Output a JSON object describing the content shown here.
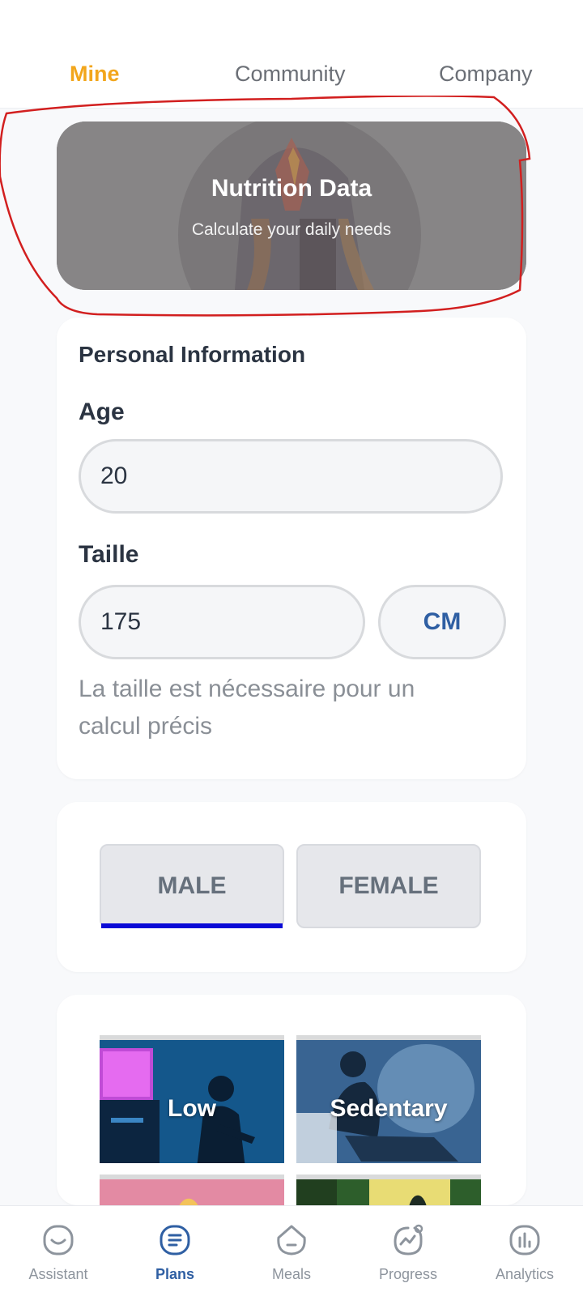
{
  "tabs": {
    "mine": "Mine",
    "community": "Community",
    "company": "Company",
    "active": "Mine"
  },
  "hero": {
    "title": "Nutrition Data",
    "subtitle": "Calculate your daily needs"
  },
  "personal": {
    "section_title": "Personal Information",
    "age_label": "Age",
    "age_value": "20",
    "height_label": "Taille",
    "height_value": "175",
    "height_unit": "CM",
    "height_hint": "La taille est nécessaire pour un calcul précis"
  },
  "gender": {
    "male": "MALE",
    "female": "FEMALE",
    "selected": "MALE"
  },
  "activity": {
    "options": [
      "Low",
      "Sedentary"
    ]
  },
  "bottom_nav": {
    "items": [
      {
        "label": "Assistant",
        "icon": "assistant-face-icon"
      },
      {
        "label": "Plans",
        "icon": "plans-list-icon"
      },
      {
        "label": "Meals",
        "icon": "meals-icon"
      },
      {
        "label": "Progress",
        "icon": "progress-chart-icon"
      },
      {
        "label": "Analytics",
        "icon": "analytics-bars-icon"
      }
    ],
    "active": "Plans"
  },
  "colors": {
    "accent_orange": "#f2a61c",
    "active_blue": "#2f5fa3",
    "selection_bar": "#0a0ad6",
    "annotation_red": "#d21f1f"
  }
}
